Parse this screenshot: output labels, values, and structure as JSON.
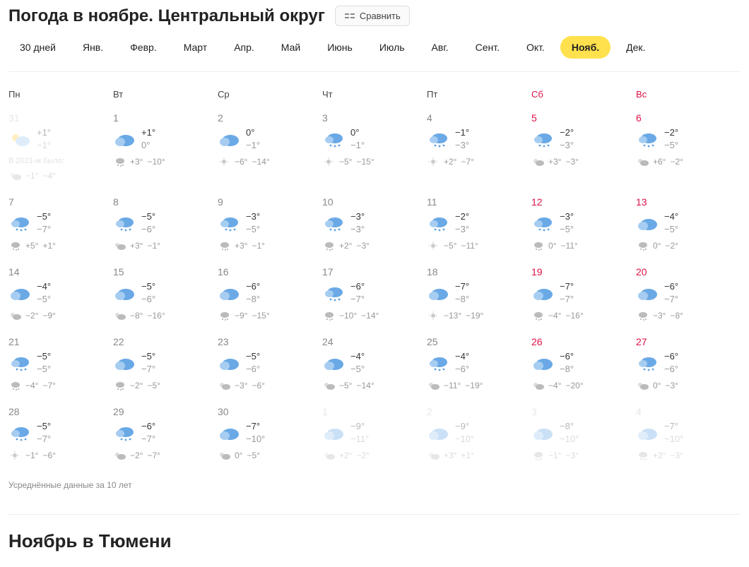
{
  "header": {
    "title": "Погода в ноябре. Центральный округ",
    "compare_label": "Сравнить"
  },
  "month_tabs": [
    "30 дней",
    "Янв.",
    "Февр.",
    "Март",
    "Апр.",
    "Май",
    "Июнь",
    "Июль",
    "Авг.",
    "Сент.",
    "Окт.",
    "Нояб.",
    "Дек."
  ],
  "active_month": "Нояб.",
  "weekdays": [
    {
      "label": "Пн",
      "weekend": false
    },
    {
      "label": "Вт",
      "weekend": false
    },
    {
      "label": "Ср",
      "weekend": false
    },
    {
      "label": "Чт",
      "weekend": false
    },
    {
      "label": "Пт",
      "weekend": false
    },
    {
      "label": "Сб",
      "weekend": true
    },
    {
      "label": "Вс",
      "weekend": true
    }
  ],
  "past_note": "В 2021-м было:",
  "days": [
    {
      "n": "31",
      "faded": true,
      "weekend": false,
      "pastnote": true,
      "icon": "partly",
      "hi": "+1°",
      "lo": "−1°",
      "hicon": "partly",
      "hh": "−1°",
      "hl": "−4°"
    },
    {
      "n": "1",
      "faded": false,
      "weekend": false,
      "icon": "cloudy",
      "hi": "+1°",
      "lo": "0°",
      "hicon": "snow",
      "hh": "+3°",
      "hl": "−10°"
    },
    {
      "n": "2",
      "faded": false,
      "weekend": false,
      "icon": "cloudy",
      "hi": "0°",
      "lo": "−1°",
      "hicon": "sunny",
      "hh": "−6°",
      "hl": "−14°"
    },
    {
      "n": "3",
      "faded": false,
      "weekend": false,
      "icon": "snow",
      "hi": "0°",
      "lo": "−1°",
      "hicon": "sunny",
      "hh": "−5°",
      "hl": "−15°"
    },
    {
      "n": "4",
      "faded": false,
      "weekend": false,
      "icon": "snow",
      "hi": "−1°",
      "lo": "−3°",
      "hicon": "sunny",
      "hh": "+2°",
      "hl": "−7°"
    },
    {
      "n": "5",
      "faded": false,
      "weekend": true,
      "icon": "snow",
      "hi": "−2°",
      "lo": "−3°",
      "hicon": "partly",
      "hh": "+3°",
      "hl": "−3°"
    },
    {
      "n": "6",
      "faded": false,
      "weekend": true,
      "icon": "snow",
      "hi": "−2°",
      "lo": "−5°",
      "hicon": "partly",
      "hh": "+6°",
      "hl": "−2°"
    },
    {
      "n": "7",
      "faded": false,
      "weekend": false,
      "icon": "snow",
      "hi": "−5°",
      "lo": "−7°",
      "hicon": "snow",
      "hh": "+5°",
      "hl": "+1°"
    },
    {
      "n": "8",
      "faded": false,
      "weekend": false,
      "icon": "snow",
      "hi": "−5°",
      "lo": "−6°",
      "hicon": "partly",
      "hh": "+3°",
      "hl": "−1°"
    },
    {
      "n": "9",
      "faded": false,
      "weekend": false,
      "icon": "snow",
      "hi": "−3°",
      "lo": "−5°",
      "hicon": "snow",
      "hh": "+3°",
      "hl": "−1°"
    },
    {
      "n": "10",
      "faded": false,
      "weekend": false,
      "icon": "snow",
      "hi": "−3°",
      "lo": "−3°",
      "hicon": "snow",
      "hh": "+2°",
      "hl": "−3°"
    },
    {
      "n": "11",
      "faded": false,
      "weekend": false,
      "icon": "snow",
      "hi": "−2°",
      "lo": "−3°",
      "hicon": "sunny",
      "hh": "−5°",
      "hl": "−11°"
    },
    {
      "n": "12",
      "faded": false,
      "weekend": true,
      "icon": "snow",
      "hi": "−3°",
      "lo": "−5°",
      "hicon": "snow",
      "hh": "0°",
      "hl": "−11°"
    },
    {
      "n": "13",
      "faded": false,
      "weekend": true,
      "icon": "cloudy",
      "hi": "−4°",
      "lo": "−5°",
      "hicon": "snow",
      "hh": "0°",
      "hl": "−2°"
    },
    {
      "n": "14",
      "faded": false,
      "weekend": false,
      "icon": "cloudy",
      "hi": "−4°",
      "lo": "−5°",
      "hicon": "partly",
      "hh": "−2°",
      "hl": "−9°"
    },
    {
      "n": "15",
      "faded": false,
      "weekend": false,
      "icon": "cloudy",
      "hi": "−5°",
      "lo": "−6°",
      "hicon": "partly",
      "hh": "−8°",
      "hl": "−16°"
    },
    {
      "n": "16",
      "faded": false,
      "weekend": false,
      "icon": "cloudy",
      "hi": "−6°",
      "lo": "−8°",
      "hicon": "snow",
      "hh": "−9°",
      "hl": "−15°"
    },
    {
      "n": "17",
      "faded": false,
      "weekend": false,
      "icon": "snow",
      "hi": "−6°",
      "lo": "−7°",
      "hicon": "snow",
      "hh": "−10°",
      "hl": "−14°"
    },
    {
      "n": "18",
      "faded": false,
      "weekend": false,
      "icon": "cloudy",
      "hi": "−7°",
      "lo": "−8°",
      "hicon": "sunny",
      "hh": "−13°",
      "hl": "−19°"
    },
    {
      "n": "19",
      "faded": false,
      "weekend": true,
      "icon": "cloudy",
      "hi": "−7°",
      "lo": "−7°",
      "hicon": "snow",
      "hh": "−4°",
      "hl": "−16°"
    },
    {
      "n": "20",
      "faded": false,
      "weekend": true,
      "icon": "cloudy",
      "hi": "−6°",
      "lo": "−7°",
      "hicon": "snow",
      "hh": "−3°",
      "hl": "−8°"
    },
    {
      "n": "21",
      "faded": false,
      "weekend": false,
      "icon": "snow",
      "hi": "−5°",
      "lo": "−5°",
      "hicon": "snow",
      "hh": "−4°",
      "hl": "−7°"
    },
    {
      "n": "22",
      "faded": false,
      "weekend": false,
      "icon": "cloudy",
      "hi": "−5°",
      "lo": "−7°",
      "hicon": "snow",
      "hh": "−2°",
      "hl": "−5°"
    },
    {
      "n": "23",
      "faded": false,
      "weekend": false,
      "icon": "cloudy",
      "hi": "−5°",
      "lo": "−6°",
      "hicon": "partly",
      "hh": "−3°",
      "hl": "−6°"
    },
    {
      "n": "24",
      "faded": false,
      "weekend": false,
      "icon": "cloudy",
      "hi": "−4°",
      "lo": "−5°",
      "hicon": "partly",
      "hh": "−5°",
      "hl": "−14°"
    },
    {
      "n": "25",
      "faded": false,
      "weekend": false,
      "icon": "snow",
      "hi": "−4°",
      "lo": "−6°",
      "hicon": "partly",
      "hh": "−11°",
      "hl": "−19°"
    },
    {
      "n": "26",
      "faded": false,
      "weekend": true,
      "icon": "cloudy",
      "hi": "−6°",
      "lo": "−8°",
      "hicon": "partly",
      "hh": "−4°",
      "hl": "−20°"
    },
    {
      "n": "27",
      "faded": false,
      "weekend": true,
      "icon": "snow",
      "hi": "−6°",
      "lo": "−6°",
      "hicon": "partly",
      "hh": "0°",
      "hl": "−3°"
    },
    {
      "n": "28",
      "faded": false,
      "weekend": false,
      "icon": "snow",
      "hi": "−5°",
      "lo": "−7°",
      "hicon": "sunny",
      "hh": "−1°",
      "hl": "−6°"
    },
    {
      "n": "29",
      "faded": false,
      "weekend": false,
      "icon": "snow",
      "hi": "−6°",
      "lo": "−7°",
      "hicon": "partly",
      "hh": "−2°",
      "hl": "−7°"
    },
    {
      "n": "30",
      "faded": false,
      "weekend": false,
      "icon": "cloudy",
      "hi": "−7°",
      "lo": "−10°",
      "hicon": "partly",
      "hh": "0°",
      "hl": "−5°"
    },
    {
      "n": "1",
      "faded": true,
      "weekend": false,
      "icon": "cloudy",
      "hi": "−9°",
      "lo": "−11°",
      "hicon": "partly",
      "hh": "+2°",
      "hl": "−2°"
    },
    {
      "n": "2",
      "faded": true,
      "weekend": false,
      "icon": "cloudy",
      "hi": "−9°",
      "lo": "−10°",
      "hicon": "partly",
      "hh": "+3°",
      "hl": "+1°"
    },
    {
      "n": "3",
      "faded": true,
      "weekend": true,
      "icon": "cloudy",
      "hi": "−8°",
      "lo": "−10°",
      "hicon": "snow",
      "hh": "−1°",
      "hl": "−3°"
    },
    {
      "n": "4",
      "faded": true,
      "weekend": true,
      "icon": "cloudy",
      "hi": "−7°",
      "lo": "−10°",
      "hicon": "snow",
      "hh": "+2°",
      "hl": "−3°"
    }
  ],
  "footer_note": "Усреднённые данные за 10 лет",
  "section_heading": "Ноябрь в Тюмени"
}
